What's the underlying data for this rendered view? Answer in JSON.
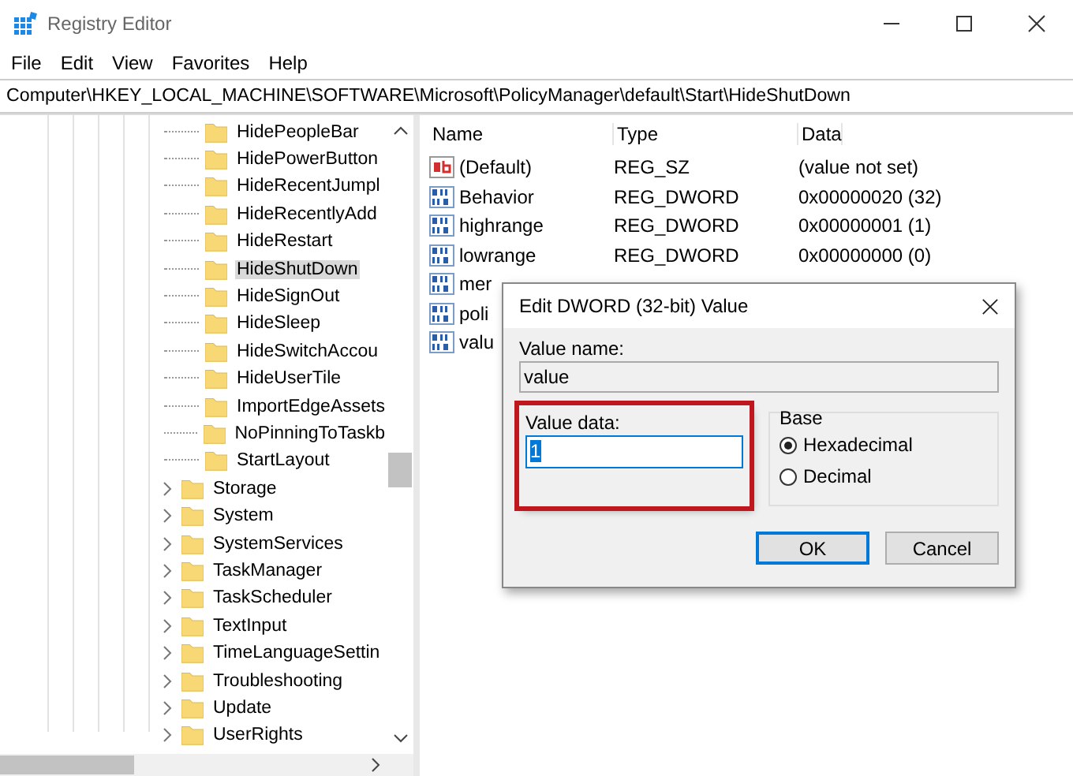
{
  "window": {
    "title": "Registry Editor"
  },
  "menu": [
    "File",
    "Edit",
    "View",
    "Favorites",
    "Help"
  ],
  "address": "Computer\\HKEY_LOCAL_MACHINE\\SOFTWARE\\Microsoft\\PolicyManager\\default\\Start\\HideShutDown",
  "tree": {
    "start_children": [
      {
        "label": "HidePeopleBar",
        "selected": false
      },
      {
        "label": "HidePowerButton",
        "selected": false
      },
      {
        "label": "HideRecentJumpl",
        "selected": false
      },
      {
        "label": "HideRecentlyAdd",
        "selected": false
      },
      {
        "label": "HideRestart",
        "selected": false
      },
      {
        "label": "HideShutDown",
        "selected": true
      },
      {
        "label": "HideSignOut",
        "selected": false
      },
      {
        "label": "HideSleep",
        "selected": false
      },
      {
        "label": "HideSwitchAccou",
        "selected": false
      },
      {
        "label": "HideUserTile",
        "selected": false
      },
      {
        "label": "ImportEdgeAssets",
        "selected": false
      },
      {
        "label": "NoPinningToTaskb",
        "selected": false
      },
      {
        "label": "StartLayout",
        "selected": false
      }
    ],
    "items": [
      {
        "label": "Storage",
        "selected": false,
        "expandable": true
      },
      {
        "label": "System",
        "selected": false,
        "expandable": true
      },
      {
        "label": "SystemServices",
        "selected": false,
        "expandable": true
      },
      {
        "label": "TaskManager",
        "selected": false,
        "expandable": true
      },
      {
        "label": "TaskScheduler",
        "selected": false,
        "expandable": true
      },
      {
        "label": "TextInput",
        "selected": false,
        "expandable": true
      },
      {
        "label": "TimeLanguageSettin",
        "selected": false,
        "expandable": true
      },
      {
        "label": "Troubleshooting",
        "selected": false,
        "expandable": true
      },
      {
        "label": "Update",
        "selected": false,
        "expandable": true
      },
      {
        "label": "UserRights",
        "selected": false,
        "expandable": true
      }
    ]
  },
  "values": {
    "columns": [
      "Name",
      "Type",
      "Data"
    ],
    "rows": [
      {
        "kind": "string",
        "name": "(Default)",
        "type": "REG_SZ",
        "data": "(value not set)"
      },
      {
        "kind": "dword",
        "name": "Behavior",
        "type": "REG_DWORD",
        "data": "0x00000020 (32)"
      },
      {
        "kind": "dword",
        "name": "highrange",
        "type": "REG_DWORD",
        "data": "0x00000001 (1)"
      },
      {
        "kind": "dword",
        "name": "lowrange",
        "type": "REG_DWORD",
        "data": "0x00000000 (0)"
      },
      {
        "kind": "dword",
        "name": "mer"
      },
      {
        "kind": "dword",
        "name": "poli"
      },
      {
        "kind": "dword",
        "name": "valu"
      }
    ]
  },
  "dialog": {
    "title": "Edit DWORD (32-bit) Value",
    "value_name_label": "Value name:",
    "value_name": "value",
    "value_data_label": "Value data:",
    "value_data": "1",
    "value_data_highlighted": true,
    "base_label": "Base",
    "radios": [
      {
        "label": "Hexadecimal",
        "selected": true
      },
      {
        "label": "Decimal",
        "selected": false
      }
    ],
    "buttons": [
      {
        "label": "OK",
        "default": true
      },
      {
        "label": "Cancel",
        "default": false
      }
    ]
  }
}
